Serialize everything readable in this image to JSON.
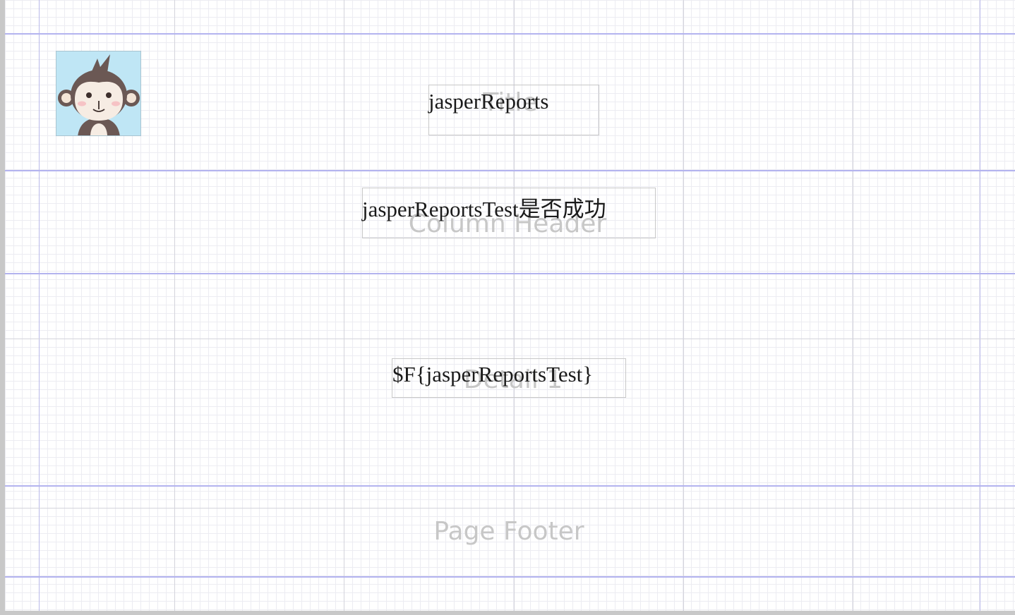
{
  "report": {
    "bands": {
      "title": "Title",
      "column_header": "Column Header",
      "detail": "Detail 1",
      "page_footer": "Page Footer"
    },
    "elements": {
      "title_text": "jasperReports",
      "header_text": "jasperReportsTest是否成功",
      "detail_field": "$F{jasperReportsTest}"
    },
    "logo_icon": "monkey-avatar-icon",
    "colors": {
      "band_line": "#b3b3ef",
      "grid": "#ececf2",
      "band_label": "#c7c7c7"
    }
  }
}
